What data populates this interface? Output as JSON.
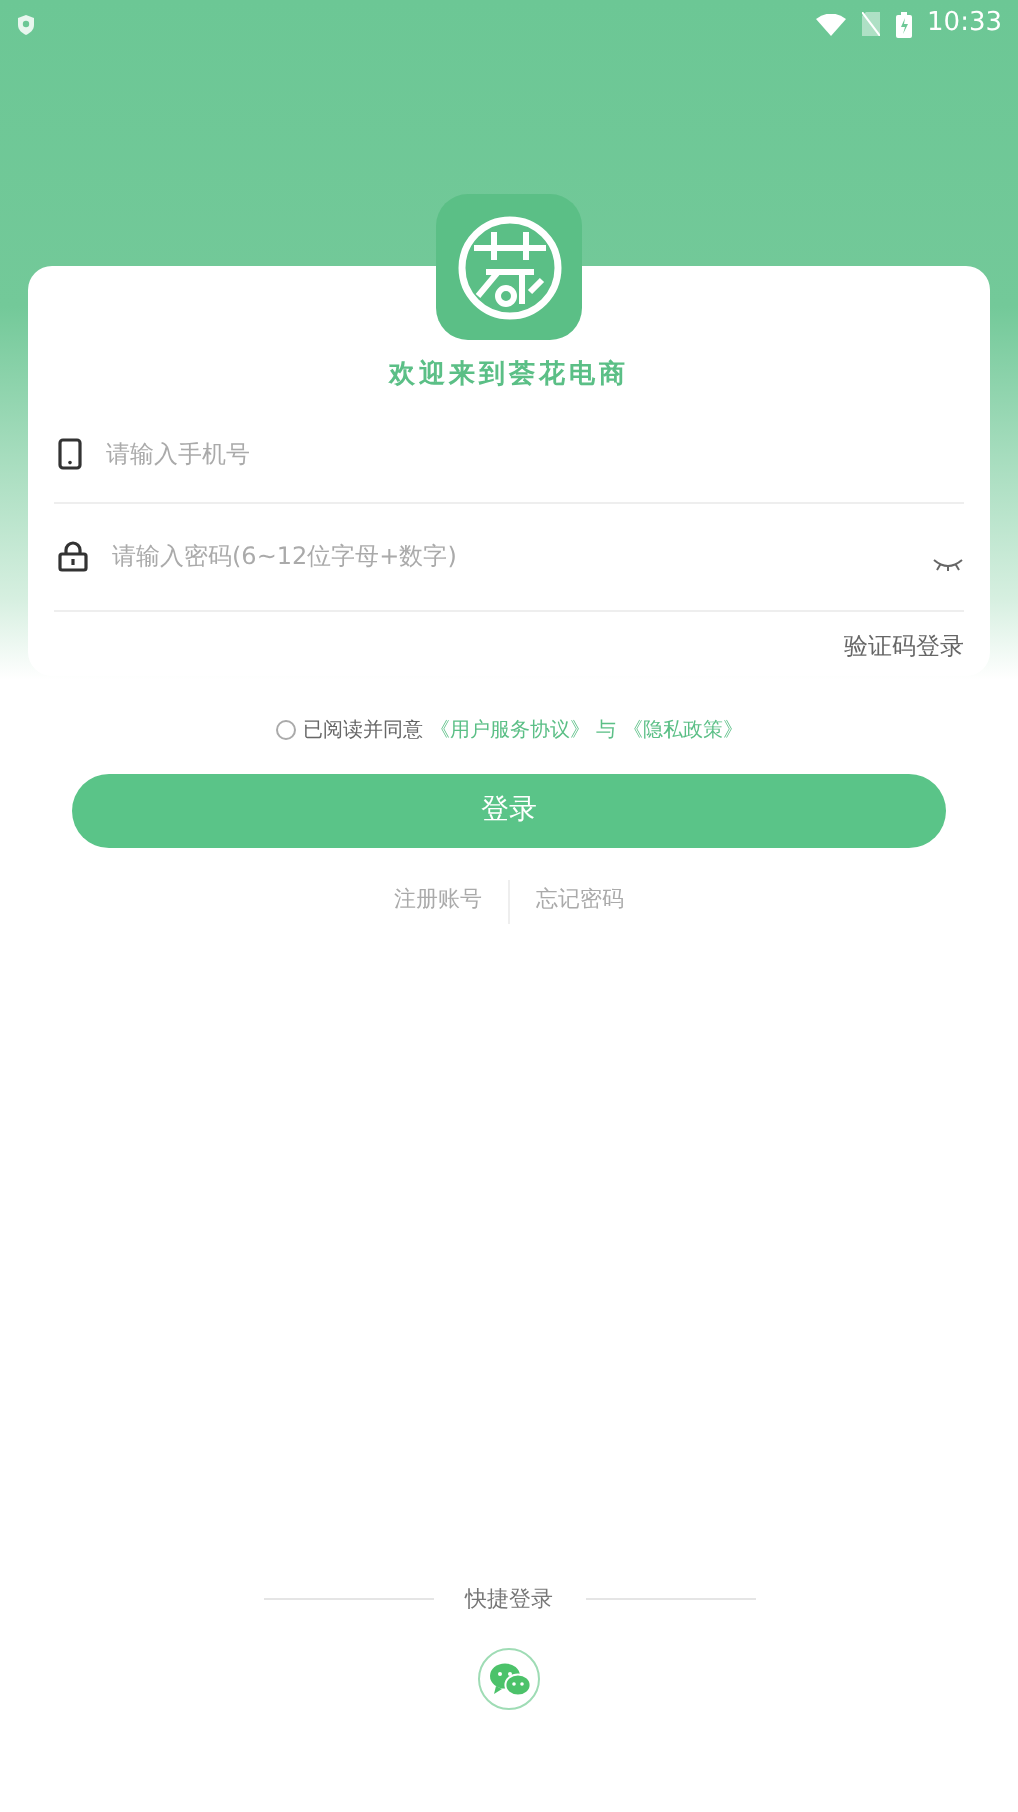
{
  "status_bar": {
    "time": "10:33"
  },
  "title": "欢迎来到荟花电商",
  "fields": [
    {
      "kind": "phone",
      "placeholder": "请输入手机号"
    },
    {
      "kind": "password",
      "placeholder": "请输入密码(6~12位字母+数字)"
    }
  ],
  "sms_login": "验证码登录",
  "agreement": {
    "checked": false,
    "prefix": "已阅读并同意",
    "terms_link": "《用户服务协议》",
    "joiner": "与",
    "privacy_link": "《隐私政策》"
  },
  "login_button": "登录",
  "links": [
    "注册账号",
    "忘记密码"
  ],
  "quick_login": {
    "label": "快捷登录"
  }
}
